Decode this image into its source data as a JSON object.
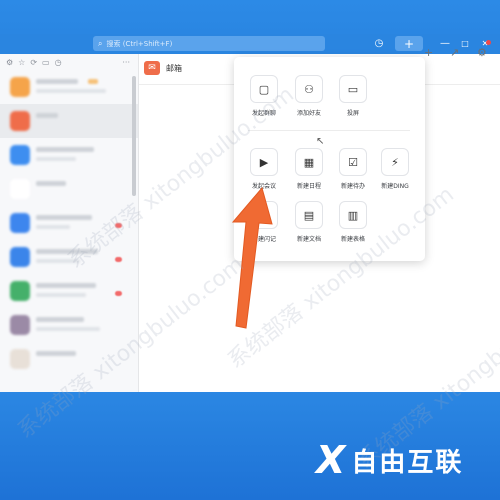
{
  "search": {
    "placeholder": "搜索 (Ctrl+Shift+F)"
  },
  "titlebar": {
    "history_icon": "history-icon",
    "plus_label": "+",
    "min": "—",
    "max": "□",
    "close": "✕"
  },
  "mail": {
    "title": "邮箱",
    "icon": "✉"
  },
  "popup": {
    "items": [
      {
        "label": "发起群聊",
        "icon": "chat-bubble-icon",
        "glyph": "▢"
      },
      {
        "label": "添加好友",
        "icon": "add-user-icon",
        "glyph": "⚇"
      },
      {
        "label": "投屏",
        "icon": "cast-icon",
        "glyph": "▭"
      },
      {
        "label": "发起会议",
        "icon": "video-camera-icon",
        "glyph": "▶"
      },
      {
        "label": "新建日程",
        "icon": "calendar-icon",
        "glyph": "▦"
      },
      {
        "label": "新建待办",
        "icon": "checkbox-icon",
        "glyph": "☑"
      },
      {
        "label": "新建DING",
        "icon": "lightning-icon",
        "glyph": "⚡"
      },
      {
        "label": "新建闪记",
        "icon": "note-icon",
        "glyph": "✎"
      },
      {
        "label": "新建文档",
        "icon": "document-icon",
        "glyph": "▤"
      },
      {
        "label": "新建表格",
        "icon": "spreadsheet-icon",
        "glyph": "▥"
      }
    ]
  },
  "watermark": "系统部落 xitongbuluo.com",
  "brand": {
    "mark": "X",
    "name": "自由互联"
  },
  "colors": {
    "titlebar": "#2a85e0",
    "mail_icon": "#ef6d4a",
    "arrow": "#f06a33",
    "desktop": "#1f78d8"
  }
}
